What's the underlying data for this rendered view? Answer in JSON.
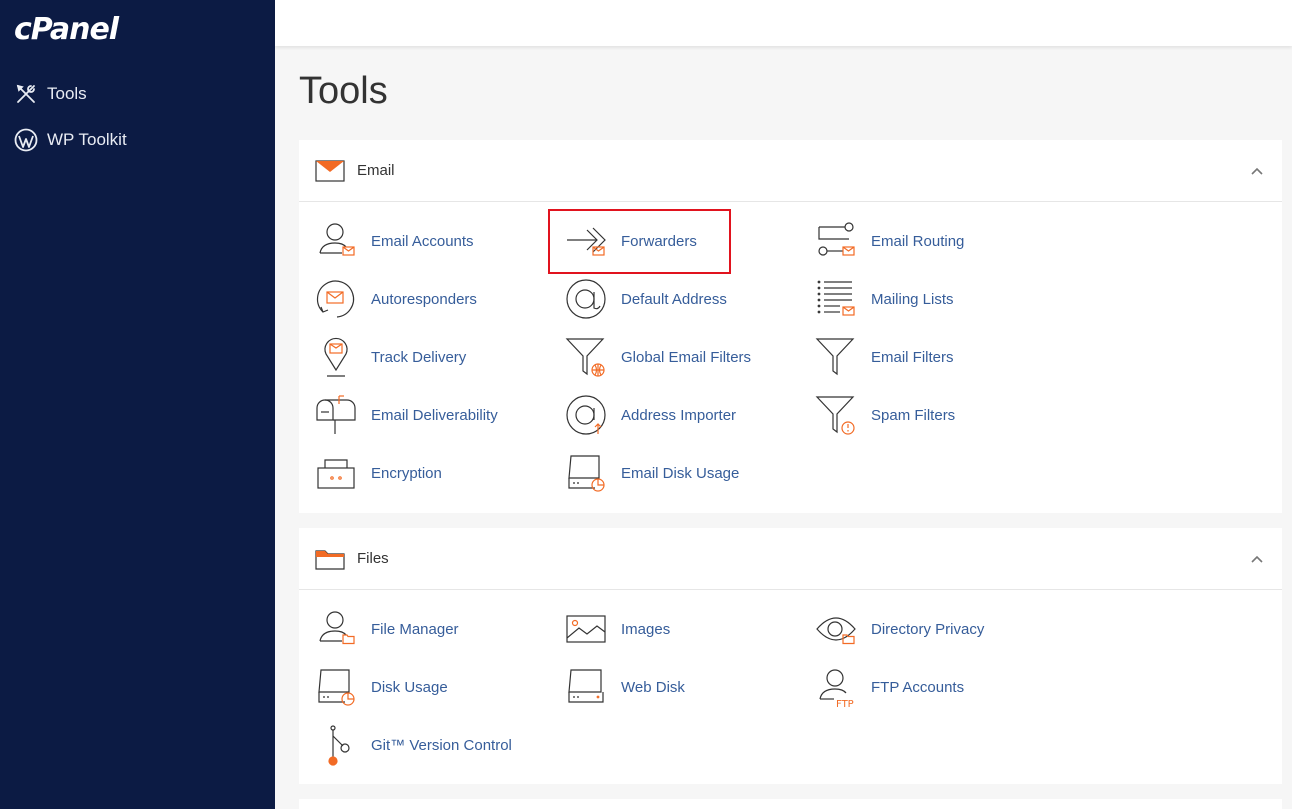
{
  "brand": {
    "logo": "cPanel"
  },
  "sidebar": {
    "items": [
      {
        "label": "Tools",
        "icon": "tools-icon"
      },
      {
        "label": "WP Toolkit",
        "icon": "wordpress-icon"
      }
    ]
  },
  "page": {
    "title": "Tools"
  },
  "colors": {
    "sidebar_bg": "#0c1b44",
    "link": "#365d9a",
    "accent": "#f26b25",
    "highlight": "#e1131e"
  },
  "email": {
    "title": "Email",
    "items": [
      "Email Accounts",
      "Forwarders",
      "Email Routing",
      "Autoresponders",
      "Default Address",
      "Mailing Lists",
      "Track Delivery",
      "Global Email Filters",
      "Email Filters",
      "Email Deliverability",
      "Address Importer",
      "Spam Filters",
      "Encryption",
      "Email Disk Usage"
    ]
  },
  "files": {
    "title": "Files",
    "items": [
      "File Manager",
      "Images",
      "Directory Privacy",
      "Disk Usage",
      "Web Disk",
      "FTP Accounts",
      "Git™ Version Control"
    ],
    "ftp_badge": "FTP"
  }
}
